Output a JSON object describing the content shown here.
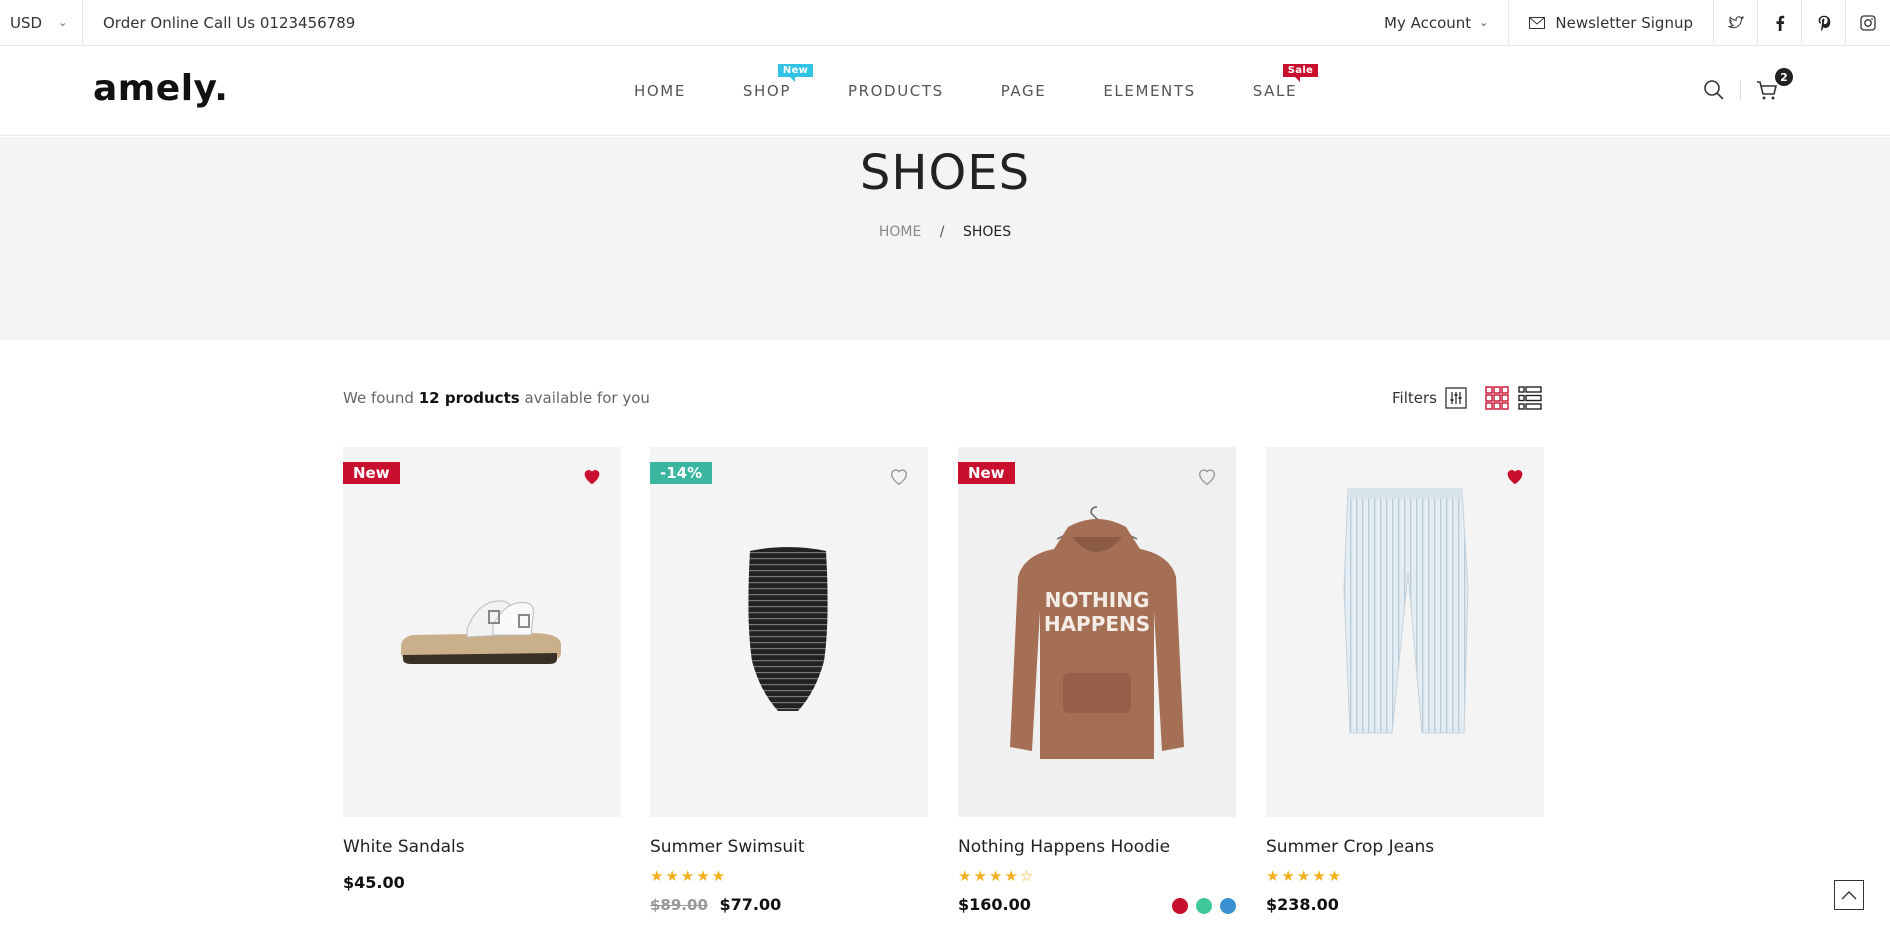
{
  "topbar": {
    "currency": "USD",
    "order_text": "Order Online Call Us 0123456789",
    "account_label": "My Account",
    "newsletter_label": "Newsletter Signup",
    "social_icons": [
      "twitter-icon",
      "facebook-icon",
      "pinterest-icon",
      "instagram-icon"
    ]
  },
  "header": {
    "logo": "amely.",
    "nav": [
      {
        "label": "HOME"
      },
      {
        "label": "SHOP",
        "badge": "New"
      },
      {
        "label": "PRODUCTS"
      },
      {
        "label": "PAGE"
      },
      {
        "label": "ELEMENTS"
      },
      {
        "label": "SALE",
        "badge": "Sale"
      }
    ],
    "cart_count": "2"
  },
  "page": {
    "title": "SHOES",
    "breadcrumb": {
      "home": "HOME",
      "sep": "/",
      "current": "SHOES"
    }
  },
  "toolbar": {
    "found_prefix": "We found",
    "found_count": "12 products",
    "found_suffix": "available for you",
    "filters_label": "Filters"
  },
  "products": [
    {
      "name": "White Sandals",
      "price": "$45.00",
      "old_price": "",
      "tag": "New",
      "rating": 0,
      "wishlisted": true,
      "swatches": []
    },
    {
      "name": "Summer Swimsuit",
      "price": "$77.00",
      "old_price": "$89.00",
      "tag": "-14%",
      "rating": 5,
      "wishlisted": false,
      "swatches": []
    },
    {
      "name": "Nothing Happens Hoodie",
      "price": "$160.00",
      "old_price": "",
      "tag": "New",
      "rating": 4,
      "wishlisted": false,
      "swatches": [
        "#c8102e",
        "#3fc79a",
        "#3a8fd0"
      ],
      "print": [
        "NOTHING",
        "HAPPENS"
      ]
    },
    {
      "name": "Summer Crop Jeans",
      "price": "$238.00",
      "old_price": "",
      "tag": "",
      "rating": 5,
      "wishlisted": true,
      "swatches": []
    }
  ],
  "colors": {
    "accent_red": "#c8102e",
    "badge_cyan": "#31c3e5",
    "tag_teal": "#3ab5a0",
    "star": "#f2b01e"
  }
}
